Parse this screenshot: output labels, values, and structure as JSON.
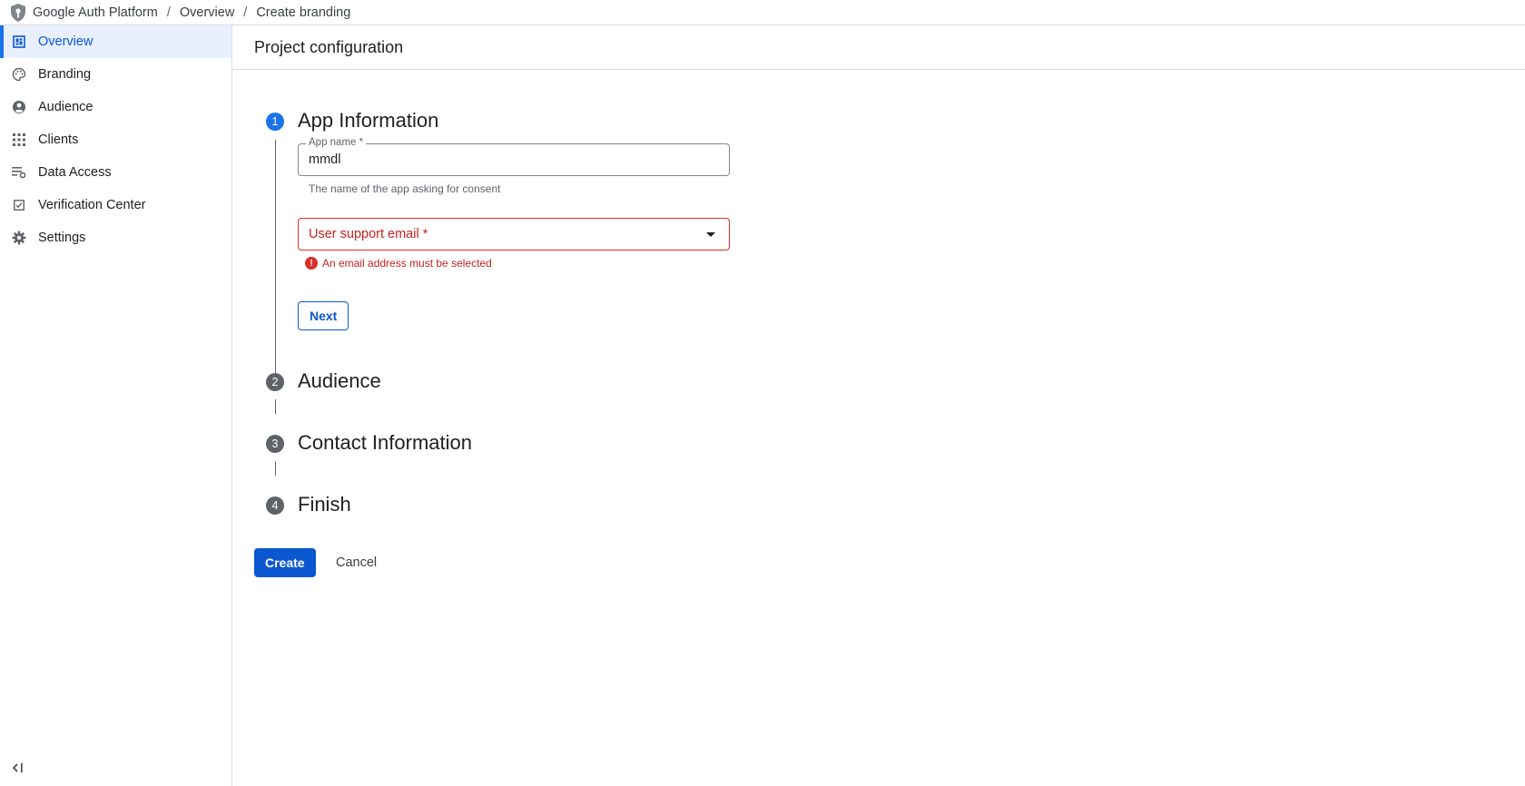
{
  "breadcrumb": {
    "items": [
      "Google Auth Platform",
      "Overview",
      "Create branding"
    ],
    "separator": "/"
  },
  "sidebar": {
    "items": [
      {
        "label": "Overview",
        "icon": "dashboard-icon",
        "active": true
      },
      {
        "label": "Branding",
        "icon": "palette-icon",
        "active": false
      },
      {
        "label": "Audience",
        "icon": "account-circle-icon",
        "active": false
      },
      {
        "label": "Clients",
        "icon": "apps-grid-icon",
        "active": false
      },
      {
        "label": "Data Access",
        "icon": "filter-settings-icon",
        "active": false
      },
      {
        "label": "Verification Center",
        "icon": "checklist-icon",
        "active": false
      },
      {
        "label": "Settings",
        "icon": "gear-icon",
        "active": false
      }
    ],
    "collapse_icon": "collapse-left-icon"
  },
  "page": {
    "title": "Project configuration"
  },
  "steps": [
    {
      "number": "1",
      "title": "App Information",
      "state": "active"
    },
    {
      "number": "2",
      "title": "Audience",
      "state": "todo"
    },
    {
      "number": "3",
      "title": "Contact Information",
      "state": "todo"
    },
    {
      "number": "4",
      "title": "Finish",
      "state": "todo"
    }
  ],
  "form": {
    "app_name": {
      "label": "App name *",
      "value": "mmdl",
      "helper": "The name of the app asking for consent"
    },
    "support_email": {
      "label": "User support email *",
      "error": "An email address must be selected"
    },
    "next_label": "Next"
  },
  "actions": {
    "create_label": "Create",
    "cancel_label": "Cancel"
  },
  "colors": {
    "accent": "#0b57d0",
    "error": "#d93025",
    "active_bg": "#e8f0fe"
  }
}
